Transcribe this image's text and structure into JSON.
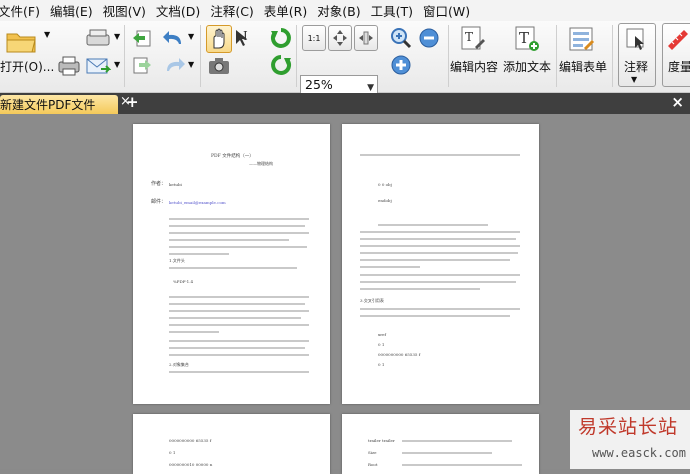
{
  "menu": [
    "文件(F)",
    "编辑(E)",
    "视图(V)",
    "文档(D)",
    "注释(C)",
    "表单(R)",
    "对象(B)",
    "工具(T)",
    "窗口(W)"
  ],
  "toolbar": {
    "open_label": "打开(O)...",
    "zoom_value": "25%",
    "edit_content_label": "编辑内容",
    "add_text_label": "添加文本",
    "edit_form_label": "编辑表单",
    "comment_label": "注释",
    "measure_label": "度量",
    "fit_label": "1:1"
  },
  "tab": {
    "title": "新建文件PDF文件",
    "close": "×",
    "add": "+",
    "window_close": "×"
  },
  "page1": {
    "heading": "PDF 文件结构（一）",
    "subheading": "——物理结构",
    "author_label": "作者：",
    "author": "ketubi",
    "email_label": "邮件：",
    "email": "ketubi_email@example.com",
    "section1": "1.文件头",
    "code1": "%PDF-1.4",
    "section2": "2.对象集合"
  },
  "page2": {
    "code_obj": "0 0 obj",
    "code_endobj": "endobj",
    "section3": "3.交叉引用表",
    "xref": "xref",
    "xref_range": "0 1",
    "xref_entry": "0000000000  65535  f",
    "xref_trailer": "0 1"
  },
  "page3": {
    "row1": "0000000000  65535  f",
    "row2": "0 1",
    "row3": "0000000010  00000  n"
  },
  "page4": {
    "row1": "trailer  trailer",
    "row2": "Size",
    "row3": "Root"
  },
  "watermark": {
    "main": "易采站长站",
    "sub": "www.easck.com"
  }
}
